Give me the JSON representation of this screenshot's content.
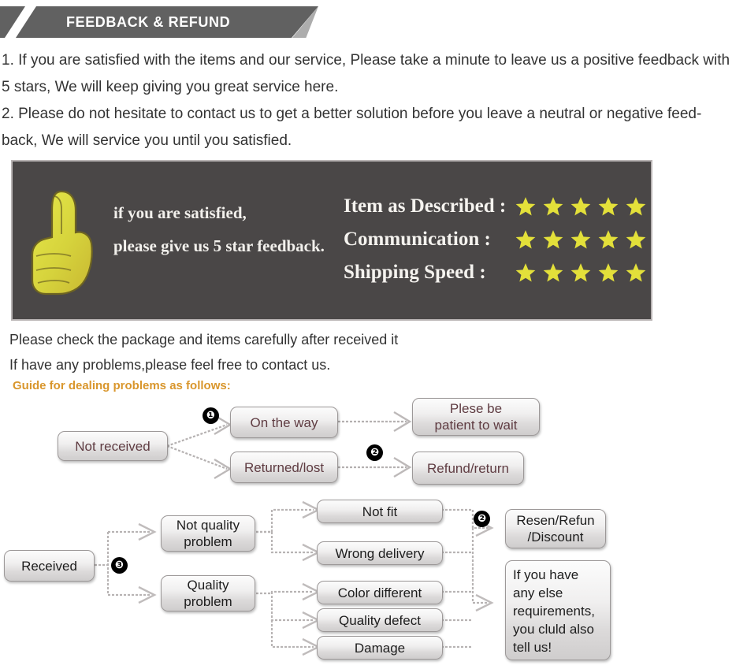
{
  "header": {
    "title": "FEEDBACK & REFUND"
  },
  "intro": {
    "p1_line1": "1. If you are satisfied with the items and our service, Please take a minute to leave us a positive feedback with",
    "p1_line2": "5 stars, We will keep giving you great service here.",
    "p2_line1": "2. Please do not hesitate to contact us to get a better solution before you leave a neutral or negative feed-",
    "p2_line2": "back, We will service you until you satisfied."
  },
  "feedback_banner": {
    "left_line1": "if you are satisfied,",
    "left_line2": "please give us 5 star feedback.",
    "thumb_icon": "thumbs-up-icon",
    "star_icon": "star-icon",
    "star_color": "#e3e03a",
    "background_color": "#4a4747",
    "ratings": [
      {
        "label": "Item as Described :",
        "stars": 5
      },
      {
        "label": "Communication :",
        "stars": 5
      },
      {
        "label": "Shipping Speed :",
        "stars": 5
      }
    ]
  },
  "notes": {
    "line1": "Please check the package and items carefully after received it",
    "line2": "If have any problems,please feel free to contact us.",
    "guide": "Guide for dealing problems as follows:",
    "guide_color": "#d9962c"
  },
  "flow_not_received": {
    "source": "Not received",
    "badges": {
      "one": "❶",
      "two": "❷"
    },
    "branch_top": "On the way",
    "branch_bottom": "Returned/lost",
    "result_top": "Plese be\npatient to wait",
    "result_bottom": "Refund/return"
  },
  "flow_received": {
    "source": "Received",
    "badges": {
      "three": "❸",
      "two": "❷"
    },
    "category_top": "Not quality\nproblem",
    "category_bottom": "Quality\nproblem",
    "reasons_top": [
      "Not fit",
      "Wrong delivery"
    ],
    "reasons_bottom": [
      "Color different",
      "Quality defect",
      "Damage"
    ],
    "result_top": "Resen/Refun\n/Discount",
    "result_bottom": "If you have\nany else\nrequirements,\nyou cluld also\ntell us!"
  }
}
